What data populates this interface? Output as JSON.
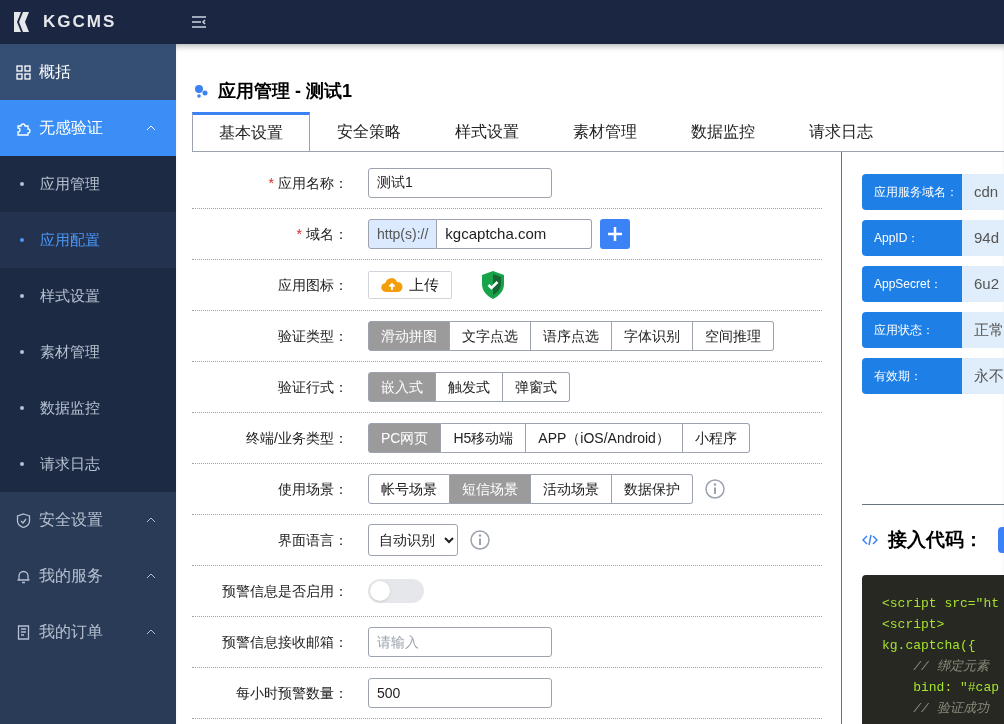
{
  "brand": {
    "name": "KGCMS"
  },
  "sidebar": {
    "items": [
      {
        "label": "概括",
        "kind": "link",
        "selected": false
      },
      {
        "label": "无感验证",
        "kind": "group",
        "selected": true,
        "children": [
          {
            "label": "应用管理",
            "selected": false
          },
          {
            "label": "应用配置",
            "selected": true
          },
          {
            "label": "样式设置",
            "selected": false
          },
          {
            "label": "素材管理",
            "selected": false
          },
          {
            "label": "数据监控",
            "selected": false
          },
          {
            "label": "请求日志",
            "selected": false
          }
        ]
      },
      {
        "label": "安全设置",
        "kind": "group",
        "selected": false
      },
      {
        "label": "我的服务",
        "kind": "group",
        "selected": false
      },
      {
        "label": "我的订单",
        "kind": "group",
        "selected": false
      }
    ]
  },
  "page": {
    "title": "应用管理 - 测试1"
  },
  "tabs": [
    {
      "label": "基本设置",
      "selected": true
    },
    {
      "label": "安全策略",
      "selected": false
    },
    {
      "label": "样式设置",
      "selected": false
    },
    {
      "label": "素材管理",
      "selected": false
    },
    {
      "label": "数据监控",
      "selected": false
    },
    {
      "label": "请求日志",
      "selected": false
    }
  ],
  "form": {
    "rows": [
      {
        "kind": "text",
        "label": "应用名称：",
        "required_mark": "*",
        "value": "测试1"
      },
      {
        "kind": "domain",
        "label": "域名：",
        "required_mark": "*",
        "prefix": "http(s)://",
        "value": "kgcaptcha.com"
      },
      {
        "kind": "upload",
        "label": "应用图标：",
        "button": "上传"
      },
      {
        "kind": "segmented",
        "label": "验证类型：",
        "options": [
          {
            "label": "滑动拼图",
            "selected": true
          },
          {
            "label": "文字点选",
            "selected": false
          },
          {
            "label": "语序点选",
            "selected": false
          },
          {
            "label": "字体识别",
            "selected": false
          },
          {
            "label": "空间推理",
            "selected": false
          }
        ]
      },
      {
        "kind": "segmented",
        "label": "验证行式：",
        "options": [
          {
            "label": "嵌入式",
            "selected": true
          },
          {
            "label": "触发式",
            "selected": false
          },
          {
            "label": "弹窗式",
            "selected": false
          }
        ]
      },
      {
        "kind": "segmented",
        "label": "终端/业务类型：",
        "options": [
          {
            "label": "PC网页",
            "selected": true
          },
          {
            "label": "H5移动端",
            "selected": false
          },
          {
            "label": "APP（iOS/Android）",
            "selected": false
          },
          {
            "label": "小程序",
            "selected": false
          }
        ]
      },
      {
        "kind": "segmented",
        "label": "使用场景：",
        "hint": true,
        "options": [
          {
            "label": "帐号场景",
            "selected": false
          },
          {
            "label": "短信场景",
            "selected": true
          },
          {
            "label": "活动场景",
            "selected": false
          },
          {
            "label": "数据保护",
            "selected": false
          }
        ]
      },
      {
        "kind": "select",
        "label": "界面语言：",
        "hint": true,
        "value": "自动识别"
      },
      {
        "kind": "toggle",
        "label": "预警信息是否启用：",
        "on": false
      },
      {
        "kind": "text",
        "label": "预警信息接收邮箱：",
        "placeholder": "请输入"
      },
      {
        "kind": "text",
        "label": "每小时预警数量：",
        "value": "500"
      }
    ]
  },
  "info": [
    {
      "label": "应用服务域名：",
      "value": "cdn"
    },
    {
      "label": "AppID：",
      "value": "94d"
    },
    {
      "label": "AppSecret：",
      "value": "6u2"
    },
    {
      "label": "应用状态：",
      "value": "正常"
    },
    {
      "label": "有效期：",
      "value": "永不"
    }
  ],
  "code": {
    "title": "接入代码：",
    "lines": [
      {
        "kind": "code",
        "text": "<script src=\"ht"
      },
      {
        "kind": "code",
        "text": "<script>"
      },
      {
        "kind": "code",
        "text": "kg.captcha({"
      },
      {
        "kind": "comment",
        "text": "    // 绑定元素"
      },
      {
        "kind": "code",
        "text": "    bind: \"#cap"
      },
      {
        "kind": "comment",
        "text": "    // 验证成功"
      }
    ]
  }
}
